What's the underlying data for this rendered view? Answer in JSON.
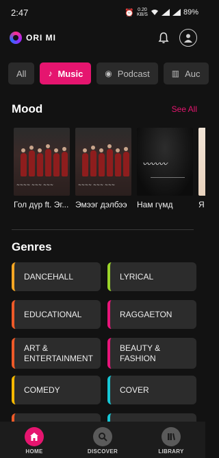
{
  "status_bar": {
    "time": "2:47",
    "speed": "0.20",
    "speed_unit": "KB/S",
    "battery": "89%"
  },
  "header": {
    "logo_text": "ORI MI"
  },
  "tabs": [
    {
      "label": "All"
    },
    {
      "label": "Music"
    },
    {
      "label": "Podcast"
    },
    {
      "label": "Auc"
    }
  ],
  "mood": {
    "title": "Mood",
    "see_all": "See All",
    "items": [
      {
        "label": "Гол дүр ft. Эг..."
      },
      {
        "label": "Эмээг дэлбээ"
      },
      {
        "label": "Нам гүмд"
      },
      {
        "label": "Я"
      }
    ]
  },
  "genres": {
    "title": "Genres",
    "items": [
      {
        "label": "DANCEHALL",
        "color": "#f5a623"
      },
      {
        "label": "LYRICAL",
        "color": "#9bd42a"
      },
      {
        "label": "EDUCATIONAL",
        "color": "#ee5a28"
      },
      {
        "label": "RAGGAETON",
        "color": "#e8157a"
      },
      {
        "label": "ART & ENTERTAINMENT",
        "color": "#ee5a28"
      },
      {
        "label": "BEAUTY & FASHION",
        "color": "#e8157a"
      },
      {
        "label": "COMEDY",
        "color": "#f5b800"
      },
      {
        "label": "COVER",
        "color": "#17c7d6"
      }
    ]
  },
  "bottom_nav": [
    {
      "label": "HOME",
      "icon": "home-icon"
    },
    {
      "label": "DISCOVER",
      "icon": "search-icon"
    },
    {
      "label": "LIBRARY",
      "icon": "library-icon"
    }
  ],
  "colors": {
    "accent": "#e5156f",
    "background": "#121212",
    "card": "#2c2c2c"
  }
}
